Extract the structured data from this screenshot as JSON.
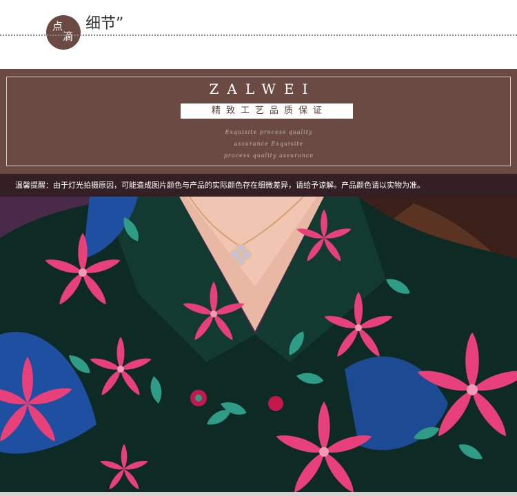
{
  "header": {
    "badge_line1": "点",
    "badge_line2": "滴",
    "title": "细节”"
  },
  "brand": {
    "name": "ZALWEI",
    "slogan": "精致工艺品质保证",
    "script_lines": [
      "Exquisite process quality",
      "assurance Exquisite",
      "process quality assurance"
    ]
  },
  "notice": {
    "text": "温馨提醒：由于灯光拍摄原因，可能造成图片颜色与产品的实际颜色存在细微差异，请给予谅解。产品颜色请以实物为准。"
  },
  "photo": {
    "subject": "floral-print-v-neck-dress-detail",
    "colors": {
      "base": "#0d2a24",
      "pink": "#e8407a",
      "blue": "#1f4fa0",
      "teal": "#2e9c86",
      "skin": "#e9b8a4",
      "hair": "#3a2018"
    }
  },
  "colors": {
    "brand_bg": "#6b4a43",
    "notice_bg": "#342024"
  }
}
